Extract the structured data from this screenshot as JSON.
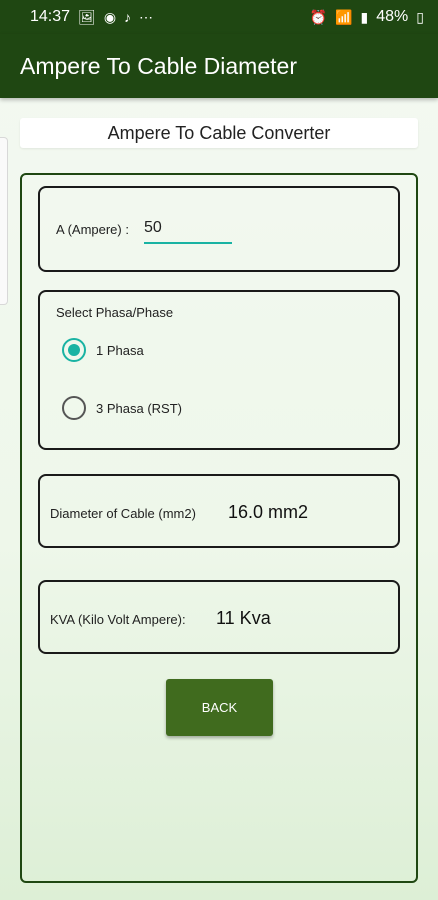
{
  "status_bar": {
    "time": "14:37",
    "battery": "48%",
    "icons_left": [
      "gallery-icon",
      "instagram-icon",
      "tiktok-icon",
      "more-icon"
    ],
    "icons_right": [
      "alarm-icon",
      "wifi-icon",
      "signal-icon",
      "battery-icon"
    ]
  },
  "app_bar": {
    "title": "Ampere To Cable Diameter"
  },
  "subtitle": "Ampere To Cable Converter",
  "ampere": {
    "label": "A (Ampere) :",
    "value": "50"
  },
  "phase": {
    "title": "Select Phasa/Phase",
    "options": [
      {
        "label": "1 Phasa",
        "selected": true
      },
      {
        "label": "3 Phasa (RST)",
        "selected": false
      }
    ]
  },
  "diameter": {
    "label": "Diameter of Cable (mm2)",
    "value": "16.0 mm2"
  },
  "kva": {
    "label": "KVA (Kilo Volt Ampere):",
    "value": "11 Kva"
  },
  "back_button": {
    "label": "BACK"
  },
  "colors": {
    "primary_dark": "#1f4712",
    "accent_teal": "#19b3a3",
    "button": "#406b1e"
  }
}
